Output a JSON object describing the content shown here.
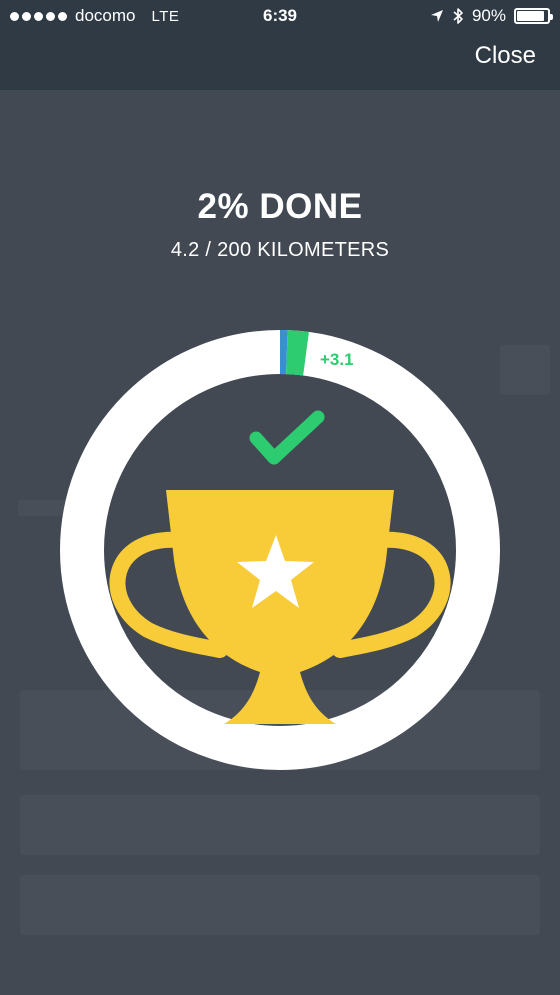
{
  "status_bar": {
    "carrier": "docomo",
    "network": "LTE",
    "time": "6:39",
    "battery": "90%",
    "battery_level": 0.9,
    "icons": [
      "signal-dots-icon",
      "location-arrow-icon",
      "bluetooth-icon",
      "battery-icon"
    ]
  },
  "header": {
    "close_label": "Close"
  },
  "progress": {
    "title": "2% DONE",
    "subtitle": "4.2 / 200 KILOMETERS",
    "done_km": 4.2,
    "goal_km": 200,
    "delta_label": "+3.1",
    "delta_km": 3.1,
    "colors": {
      "ring": "#ffffff",
      "previous": "#3a8fd0",
      "delta": "#2ecc71",
      "checkmark": "#2ecc71",
      "trophy": "#f7cc38",
      "star": "#ffffff",
      "background": "#424953"
    }
  }
}
